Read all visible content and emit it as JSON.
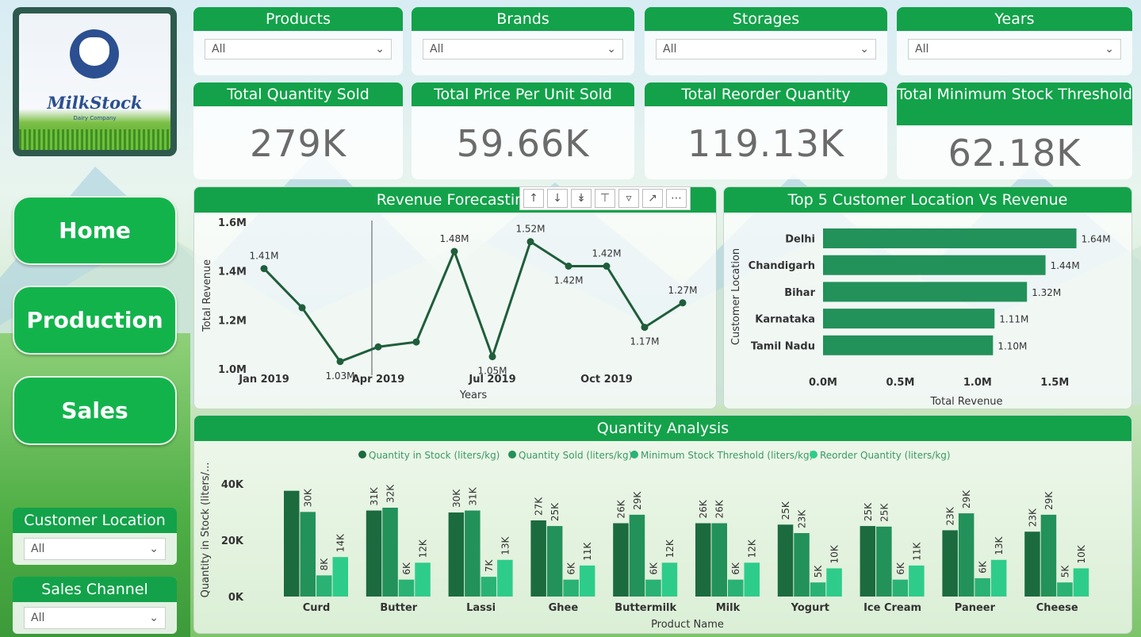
{
  "logo": {
    "name": "MilkStock",
    "subtitle": "Dairy Company"
  },
  "nav": {
    "home": "Home",
    "production": "Production",
    "sales": "Sales"
  },
  "side_slicers": {
    "customer_location": {
      "label": "Customer Location",
      "value": "All"
    },
    "sales_channel": {
      "label": "Sales Channel",
      "value": "All"
    }
  },
  "filters": [
    {
      "label": "Products",
      "value": "All"
    },
    {
      "label": "Brands",
      "value": "All"
    },
    {
      "label": "Storages",
      "value": "All"
    },
    {
      "label": "Years",
      "value": "All"
    }
  ],
  "kpis": [
    {
      "label": "Total Quantity Sold",
      "value": "279K"
    },
    {
      "label": "Total Price Per Unit Sold",
      "value": "59.66K"
    },
    {
      "label": "Total Reorder Quantity",
      "value": "119.13K"
    },
    {
      "label": "Total Minimum Stock Threshold",
      "value": "62.18K"
    }
  ],
  "toolbar": {
    "icons": [
      "arrow-up-icon",
      "arrow-down-icon",
      "double-arrow-down-icon",
      "expand-hierarchy-icon",
      "filter-icon",
      "focus-mode-icon",
      "more-options-icon"
    ]
  },
  "colors": {
    "accent": "#13a24a",
    "line": "#1f5e3a",
    "bar": "#23915a",
    "s1": "#1b6b3f",
    "s2": "#23915a",
    "s3": "#2ab274",
    "s4": "#2ecc8a"
  },
  "chart_data": [
    {
      "type": "line",
      "title": "Revenue Forecasting",
      "xlabel": "Years",
      "ylabel": "Total Revenue",
      "ylim": [
        1.0,
        1.6
      ],
      "yticks": [
        "1.0M",
        "1.2M",
        "1.4M",
        "1.6M"
      ],
      "xticks": [
        "Jan 2019",
        "Apr 2019",
        "Jul 2019",
        "Oct 2019"
      ],
      "x": [
        "Jan 2019",
        "Feb 2019",
        "Mar 2019",
        "Apr 2019",
        "May 2019",
        "Jun 2019",
        "Jul 2019",
        "Aug 2019",
        "Sep 2019",
        "Oct 2019",
        "Nov 2019",
        "Dec 2019"
      ],
      "values": [
        1.41,
        1.25,
        1.03,
        1.09,
        1.11,
        1.48,
        1.05,
        1.52,
        1.42,
        1.42,
        1.17,
        1.27
      ],
      "labels": [
        "1.41M",
        "",
        "1.03M",
        "",
        "",
        "1.48M",
        "1.05M",
        "1.52M",
        "1.42M",
        "1.42M",
        "1.17M",
        "1.27M"
      ]
    },
    {
      "type": "bar",
      "orientation": "horizontal",
      "title": "Top 5 Customer Location Vs Revenue",
      "xlabel": "Total Revenue",
      "ylabel": "Customer Location",
      "xlim": [
        0,
        1.75
      ],
      "xticks": [
        "0.0M",
        "0.5M",
        "1.0M",
        "1.5M"
      ],
      "categories": [
        "Delhi",
        "Chandigarh",
        "Bihar",
        "Karnataka",
        "Tamil Nadu"
      ],
      "values": [
        1.64,
        1.44,
        1.32,
        1.11,
        1.1
      ],
      "labels": [
        "1.64M",
        "1.44M",
        "1.32M",
        "1.11M",
        "1.10M"
      ]
    },
    {
      "type": "bar",
      "title": "Quantity Analysis",
      "xlabel": "Product Name",
      "ylabel": "Quantity in Stock (liters/...",
      "ylim": [
        0,
        45000
      ],
      "yticks": [
        "0K",
        "20K",
        "40K"
      ],
      "categories": [
        "Curd",
        "Butter",
        "Lassi",
        "Ghee",
        "Buttermilk",
        "Milk",
        "Yogurt",
        "Ice Cream",
        "Paneer",
        "Cheese"
      ],
      "series": [
        {
          "name": "Quantity in Stock (liters/kg)",
          "values": [
            37500,
            30500,
            29800,
            27000,
            26000,
            26000,
            25500,
            25000,
            23500,
            23000
          ],
          "labels": [
            "",
            "31K",
            "30K",
            "27K",
            "26K",
            "26K",
            "25K",
            "25K",
            "23K",
            "23K"
          ]
        },
        {
          "name": "Quantity Sold (liters/kg)",
          "values": [
            30000,
            31500,
            30500,
            25000,
            29000,
            26000,
            22500,
            24800,
            29500,
            29000
          ],
          "labels": [
            "30K",
            "32K",
            "31K",
            "25K",
            "29K",
            "26K",
            "23K",
            "25K",
            "29K",
            "29K"
          ]
        },
        {
          "name": "Minimum Stock Threshold (liters/kg)",
          "values": [
            7500,
            6000,
            7000,
            6000,
            6000,
            6000,
            5000,
            6000,
            6500,
            5000
          ],
          "labels": [
            "8K",
            "6K",
            "7K",
            "6K",
            "6K",
            "6K",
            "5K",
            "6K",
            "6K",
            "5K"
          ]
        },
        {
          "name": "Reorder Quantity (liters/kg)",
          "values": [
            14000,
            12000,
            13000,
            11000,
            12000,
            12000,
            10000,
            11000,
            13000,
            10000
          ],
          "labels": [
            "14K",
            "12K",
            "13K",
            "11K",
            "12K",
            "12K",
            "10K",
            "11K",
            "13K",
            "10K"
          ]
        }
      ]
    }
  ]
}
